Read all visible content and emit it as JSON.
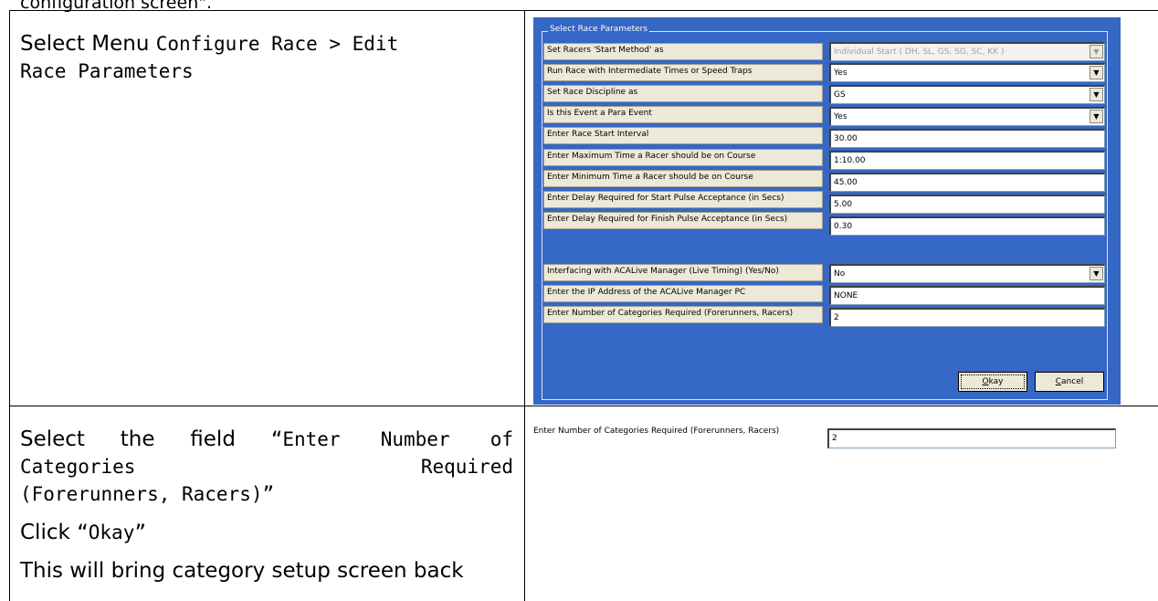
{
  "top_fragment": "configuration screen\".",
  "row1": {
    "instruction_prefix": "Select Menu ",
    "instruction_menu_line1": "Configure Race > Edit",
    "instruction_menu_line2": "Race Parameters"
  },
  "dialog": {
    "group_title": "Select Race Parameters",
    "fields": [
      {
        "label": "Set Racers 'Start Method' as",
        "value": "Individual Start ( DH, SL, GS, SG, SC, KK )",
        "kind": "dropdown",
        "disabled": true
      },
      {
        "label": "Run Race with Intermediate Times or Speed Traps",
        "value": "Yes",
        "kind": "dropdown",
        "disabled": false
      },
      {
        "label": "Set Race Discipline as",
        "value": "GS",
        "kind": "dropdown",
        "disabled": false
      },
      {
        "label": "Is this Event a Para Event",
        "value": "Yes",
        "kind": "dropdown",
        "disabled": false
      },
      {
        "label": "Enter Race Start Interval",
        "value": "30.00",
        "kind": "text",
        "disabled": false
      },
      {
        "label": "Enter Maximum Time a Racer should be on Course",
        "value": "1:10.00",
        "kind": "text",
        "disabled": false
      },
      {
        "label": "Enter Minimum Time a Racer should be on Course",
        "value": "45.00",
        "kind": "text",
        "disabled": false
      },
      {
        "label": "Enter Delay Required for Start Pulse Acceptance (in Secs)",
        "value": "5.00",
        "kind": "text",
        "disabled": false
      },
      {
        "label": "Enter Delay Required for Finish Pulse Acceptance (in Secs)",
        "value": "0.30",
        "kind": "text",
        "disabled": false
      },
      {
        "label": "Interfacing with ACALive Manager (Live Timing)   (Yes/No)",
        "value": "No",
        "kind": "dropdown",
        "disabled": false
      },
      {
        "label": "Enter the IP Address of the ACALive Manager PC",
        "value": "NONE",
        "kind": "text",
        "disabled": false
      },
      {
        "label": "Enter Number of Categories Required (Forerunners, Racers)",
        "value": "2",
        "kind": "text",
        "disabled": false
      }
    ],
    "okay_label": "Okay",
    "cancel_label": "Cancel",
    "okay_hotkey": "O",
    "okay_rest": "kay",
    "cancel_hotkey": "C",
    "cancel_rest": "ancel"
  },
  "row2": {
    "select_prefix": "Select the field ",
    "field_line1": "“Enter Number of",
    "field_line2a": "Categories",
    "field_line2b": "Required",
    "field_line3": "(Forerunners, Racers)”",
    "click_prefix": "Click ",
    "click_target": "“Okay”",
    "result_text": "This will bring category setup screen back"
  },
  "zoom": {
    "label": "Enter Number of Categories Required (Forerunners, Racers)",
    "value": "2"
  }
}
